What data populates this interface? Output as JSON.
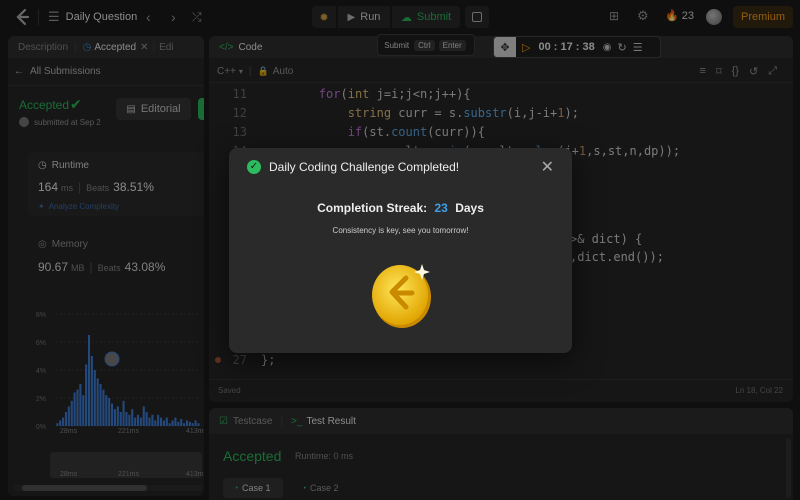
{
  "topbar": {
    "problem_list_label": "Daily Question",
    "run_label": "Run",
    "submit_label": "Submit",
    "streak_count": "23",
    "premium_label": "Premium"
  },
  "left_panel": {
    "tabs": [
      {
        "label": "Description"
      },
      {
        "label": "Accepted"
      },
      {
        "label": "Edi"
      }
    ],
    "all_submissions": "All Submissions",
    "status": "Accepted",
    "editorial_label": "Editorial",
    "submitted_at": "submitted at Sep 2",
    "runtime": {
      "title": "Runtime",
      "value": "164",
      "unit": "ms",
      "beats_label": "Beats",
      "beats_value": "38.51%",
      "analyze": "Analyze Complexity"
    },
    "memory": {
      "title": "Memory",
      "value": "90.67",
      "unit": "MB",
      "beats_label": "Beats",
      "beats_value": "43.08%"
    }
  },
  "chart_data": {
    "type": "bar",
    "yticks": [
      "8%",
      "6%",
      "4%",
      "2%",
      "0%"
    ],
    "ylim": [
      0,
      8
    ],
    "xticks": [
      "28ms",
      "221ms",
      "413ms"
    ],
    "values": [
      0.2,
      0.4,
      0.6,
      1.0,
      1.4,
      1.8,
      2.4,
      2.6,
      3.0,
      2.2,
      4.4,
      6.5,
      5.0,
      4.0,
      3.4,
      3.0,
      2.6,
      2.2,
      2.0,
      1.6,
      1.2,
      1.4,
      1.0,
      1.8,
      1.0,
      0.8,
      1.2,
      0.6,
      0.8,
      0.6,
      1.4,
      1.0,
      0.6,
      0.8,
      0.4,
      0.8,
      0.6,
      0.4,
      0.6,
      0.2,
      0.4,
      0.6,
      0.3,
      0.5,
      0.2,
      0.4,
      0.3,
      0.2,
      0.4,
      0.2
    ],
    "mini_xticks": [
      "28ms",
      "221ms",
      "413ms"
    ],
    "colors": {
      "bar": "#3f7fd9",
      "grid": "#3a3a3a"
    }
  },
  "code_panel": {
    "title": "Code",
    "language": "C++",
    "mode": "Auto",
    "saved": "Saved",
    "cursor": "Ln 18, Col 22",
    "submit_hint": {
      "label": "Submit",
      "key1": "Ctrl",
      "key2": "Enter"
    },
    "timer": "00 : 17 : 38",
    "lines": [
      {
        "n": "11",
        "segments": [
          {
            "t": "        ",
            "c": ""
          },
          {
            "t": "for",
            "c": "kw"
          },
          {
            "t": "(",
            "c": ""
          },
          {
            "t": "int",
            "c": "ty"
          },
          {
            "t": " j=i;j<n;j++){",
            "c": ""
          }
        ]
      },
      {
        "n": "12",
        "segments": [
          {
            "t": "            ",
            "c": ""
          },
          {
            "t": "string",
            "c": "ty"
          },
          {
            "t": " curr = s.",
            "c": ""
          },
          {
            "t": "substr",
            "c": "fn"
          },
          {
            "t": "(i,j-i+",
            "c": ""
          },
          {
            "t": "1",
            "c": "nm"
          },
          {
            "t": ");",
            "c": ""
          }
        ]
      },
      {
        "n": "13",
        "segments": [
          {
            "t": "            ",
            "c": ""
          },
          {
            "t": "if",
            "c": "kw"
          },
          {
            "t": "(st.",
            "c": ""
          },
          {
            "t": "count",
            "c": "fn"
          },
          {
            "t": "(curr)){",
            "c": ""
          }
        ]
      },
      {
        "n": "14",
        "segments": [
          {
            "t": "                result = ",
            "c": ""
          },
          {
            "t": "min",
            "c": "fn"
          },
          {
            "t": "(result,",
            "c": ""
          },
          {
            "t": "solve",
            "c": "fn"
          },
          {
            "t": "(j+",
            "c": ""
          },
          {
            "t": "1",
            "c": "nm"
          },
          {
            "t": ",s,st,n,dp));",
            "c": ""
          }
        ]
      }
    ],
    "partial_lines": [
      {
        "text": ">& dict) {"
      },
      {
        "text": ",dict.end());"
      }
    ],
    "last_line": {
      "n": "27",
      "text": "};"
    }
  },
  "test_panel": {
    "tab_testcase": "Testcase",
    "tab_result": "Test Result",
    "status": "Accepted",
    "runtime": "Runtime: 0 ms",
    "cases": [
      {
        "label": "Case 1"
      },
      {
        "label": "Case 2"
      }
    ]
  },
  "modal": {
    "title": "Daily Coding Challenge Completed!",
    "streak_prefix": "Completion Streak:",
    "streak_value": "23",
    "streak_suffix": "Days",
    "message": "Consistency is key, see you tomorrow!"
  }
}
